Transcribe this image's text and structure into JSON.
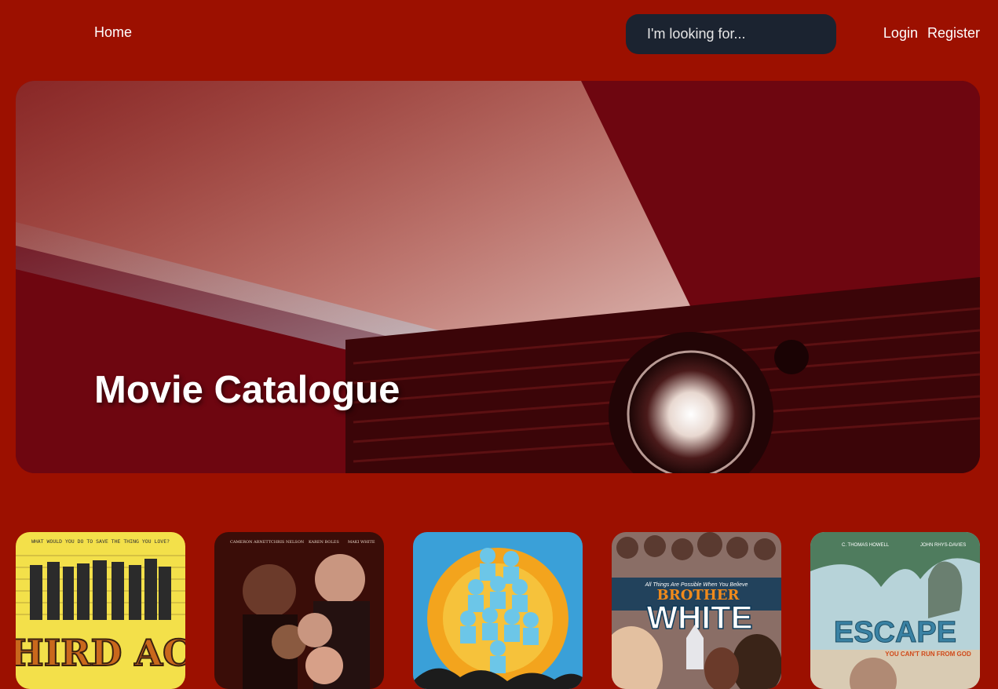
{
  "nav": {
    "home_label": "Home",
    "search_placeholder": "I'm looking for...",
    "login_label": "Login",
    "register_label": "Register"
  },
  "hero": {
    "title": "Movie Catalogue",
    "image_icon": "projector-image"
  },
  "posters": [
    {
      "tagline": "WHAT WOULD YOU DO TO SAVE THE THING YOU LOVE?",
      "title": "THIRD ACT",
      "colors": {
        "bg": "#f3e04a",
        "accent": "#c9681c"
      }
    },
    {
      "credits": [
        "CAMERON ARNETT",
        "CHRIS NELSON",
        "KAREN BOLES",
        "MAKI WHITE"
      ],
      "colors": {
        "bg": "#3a0d08",
        "accent": "#b14a1a"
      }
    },
    {
      "colors": {
        "bg": "#3aa0d8",
        "accent": "#f3a41d"
      }
    },
    {
      "tagline": "All Things Are Possible When You Believe",
      "title_line1": "BROTHER",
      "title_line2": "WHITE",
      "colors": {
        "bg": "#0f3b5a",
        "accent": "#f08a1b"
      }
    },
    {
      "credits": [
        "C. THOMAS HOWELL",
        "JOHN RHYS-DAVIES"
      ],
      "title": "ESCAPE",
      "tagline": "YOU CAN'T RUN FROM GOD",
      "colors": {
        "bg": "#8ab9c9",
        "accent": "#e8b52b"
      }
    }
  ]
}
